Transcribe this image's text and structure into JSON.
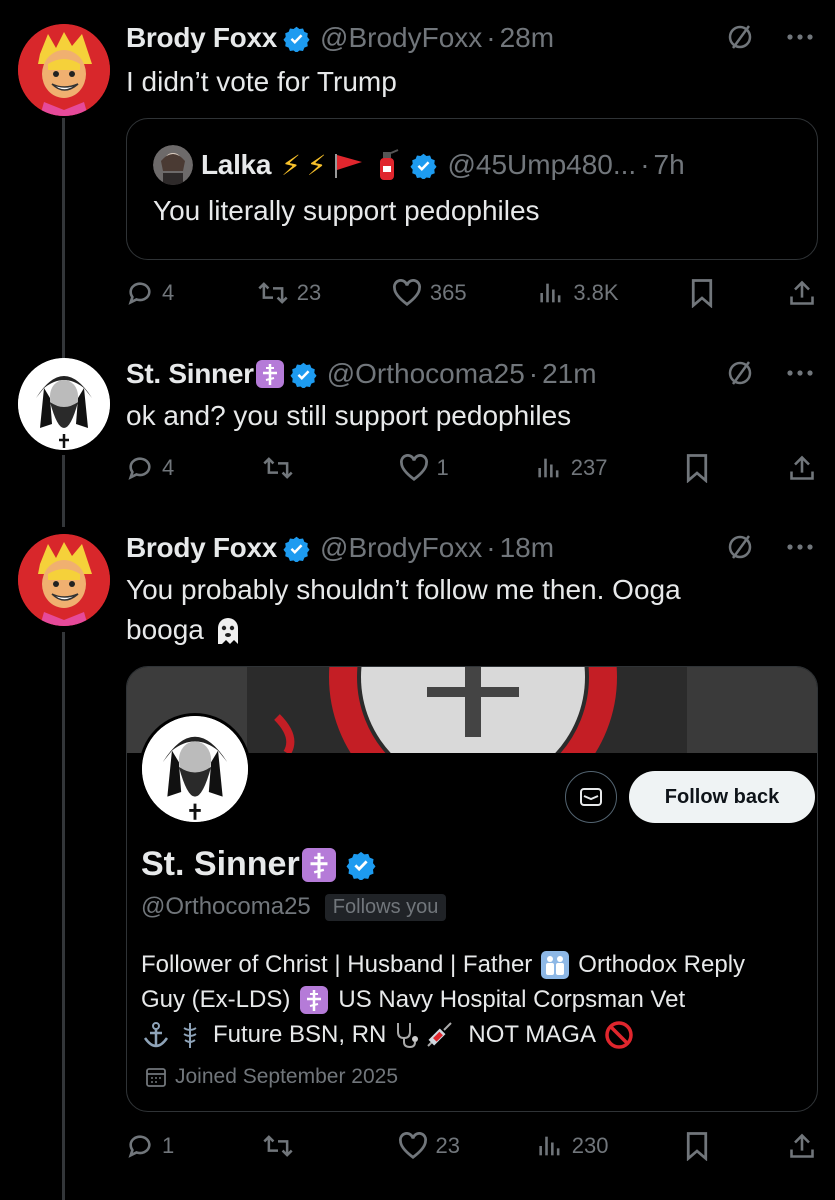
{
  "tweets": [
    {
      "name": "Brody Foxx",
      "handle": "@BrodyFoxx",
      "time": "28m",
      "text": "I didn’t vote for Trump",
      "quote": {
        "name": "Lalka",
        "handle": "@45Ump480...",
        "time": "7h",
        "text": "You literally support pedophiles",
        "emojis": [
          "lightning-icon",
          "lightning-icon",
          "red-flag-icon",
          "fire-extinguisher-icon"
        ]
      },
      "stats": {
        "replies": "4",
        "reposts": "23",
        "likes": "365",
        "views": "3.8K"
      }
    },
    {
      "name": "St. Sinner",
      "handle": "@Orthocoma25",
      "time": "21m",
      "text": "ok and? you still support pedophiles",
      "stats": {
        "replies": "4",
        "reposts": "",
        "likes": "1",
        "views": "237"
      }
    },
    {
      "name": "Brody Foxx",
      "handle": "@BrodyFoxx",
      "time": "18m",
      "text_line1": "You probably shouldn’t follow me then. Ooga",
      "text_line2": "booga",
      "text_emoji": "ghost-icon",
      "profile_card": {
        "name": "St. Sinner",
        "handle": "@Orthocoma25",
        "follows_you": "Follows you",
        "follow_back": "Follow back",
        "bio_line1_a": "Follower of Christ | Husband | Father",
        "bio_line1_b": "Orthodox Reply",
        "bio_line2_a": "Guy (Ex-LDS)",
        "bio_line2_b": "US Navy Hospital Corpsman Vet",
        "bio_line3_a": "Future BSN, RN",
        "bio_line3_b": "NOT MAGA",
        "joined": "Joined September 2025"
      },
      "stats": {
        "replies": "1",
        "reposts": "",
        "likes": "23",
        "views": "230"
      }
    }
  ],
  "colors": {
    "background": "#000000",
    "text": "#e7e9ea",
    "muted": "#71767b",
    "verified": "#1d9bf0",
    "border": "#2f3336"
  }
}
